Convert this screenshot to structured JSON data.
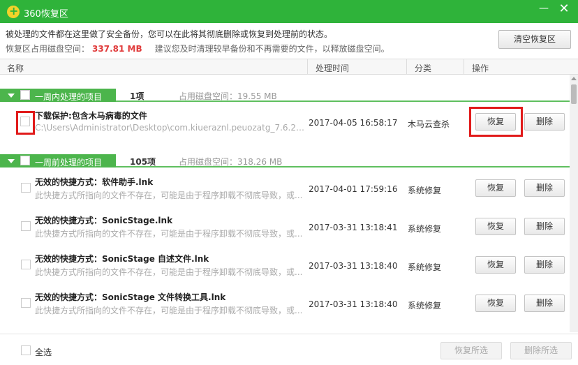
{
  "window": {
    "title": "360恢复区",
    "min_label": "—",
    "close_label": "✕"
  },
  "info": {
    "line1": "被处理的文件都在这里做了安全备份，您可以在此将其彻底删除或恢复到处理前的状态。",
    "space_label": "恢复区占用磁盘空间：",
    "space_value": "337.81 MB",
    "space_tip": "建议您及时清理较早备份和不再需要的文件，以释放磁盘空间。",
    "clear_button": "清空恢复区"
  },
  "columns": {
    "name": "名称",
    "time": "处理时间",
    "category": "分类",
    "action": "操作"
  },
  "groups": [
    {
      "label": "一周内处理的项目",
      "count": "1项",
      "space": "占用磁盘空间：19.55 MB"
    },
    {
      "label": "一周前处理的项目",
      "count": "105项",
      "space": "占用磁盘空间：318.26 MB"
    }
  ],
  "rows": [
    {
      "name": "下载保护:包含木马病毒的文件",
      "desc": "C:\\Users\\Administrator\\Desktop\\com.kiueraznl.peuozatg_7.6.2_16...",
      "time": "2017-04-05 16:58:17",
      "category": "木马云查杀",
      "restore": "恢复",
      "delete": "删除"
    },
    {
      "name": "无效的快捷方式：软件助手.lnk",
      "desc": "此快捷方式所指向的文件不存在，可能是由于程序卸载不彻底导致，或...",
      "time": "2017-04-01 17:59:16",
      "category": "系统修复",
      "restore": "恢复",
      "delete": "删除"
    },
    {
      "name": "无效的快捷方式：SonicStage.lnk",
      "desc": "此快捷方式所指向的文件不存在，可能是由于程序卸载不彻底导致，或...",
      "time": "2017-03-31 13:18:41",
      "category": "系统修复",
      "restore": "恢复",
      "delete": "删除"
    },
    {
      "name": "无效的快捷方式：SonicStage 自述文件.lnk",
      "desc": "此快捷方式所指向的文件不存在，可能是由于程序卸载不彻底导致，或...",
      "time": "2017-03-31 13:18:40",
      "category": "系统修复",
      "restore": "恢复",
      "delete": "删除"
    },
    {
      "name": "无效的快捷方式：SonicStage 文件转换工具.lnk",
      "desc": "此快捷方式所指向的文件不存在，可能是由于程序卸载不彻底导致，或...",
      "time": "2017-03-31 13:18:40",
      "category": "系统修复",
      "restore": "恢复",
      "delete": "删除"
    }
  ],
  "footer": {
    "select_all": "全选",
    "restore_selected": "恢复所选",
    "delete_selected": "删除所选"
  },
  "colors": {
    "titlebar": "#2fb33a",
    "group": "#4cb54c",
    "highlight": "#e11b1b",
    "space_value": "#e03a3a"
  }
}
